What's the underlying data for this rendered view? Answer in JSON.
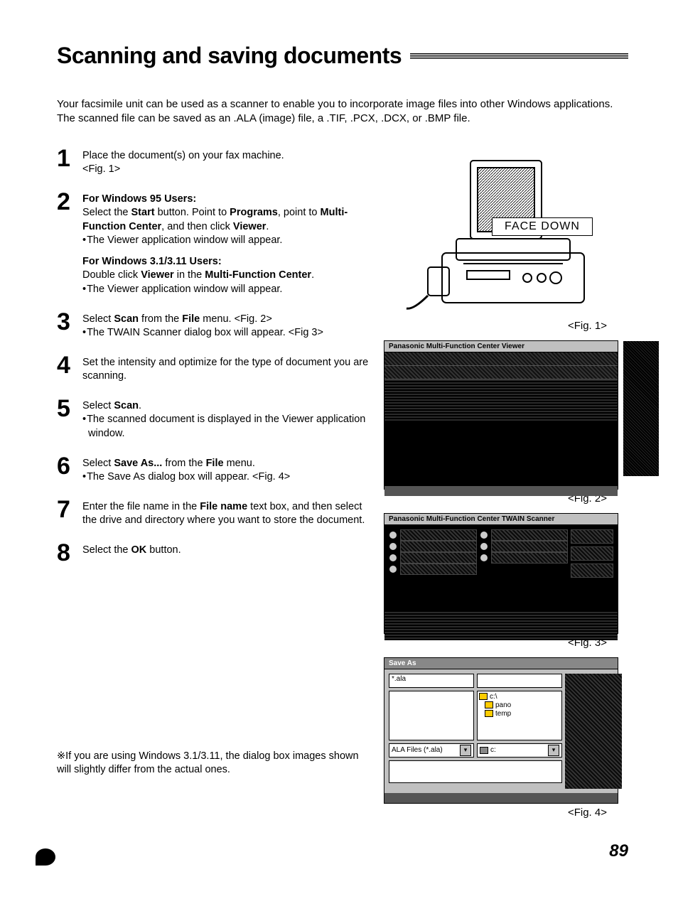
{
  "title": "Scanning and saving documents",
  "intro": "Your facsimile unit can be used as a scanner to enable you to incorporate image files into other Windows applications. The scanned file can be saved as an .ALA (image) file, a .TIF, .PCX, .DCX, or .BMP file.",
  "steps": {
    "s1": {
      "num": "1",
      "line1": "Place the document(s) on your fax machine.",
      "line2": "<Fig. 1>"
    },
    "s2": {
      "num": "2",
      "h1": "For Windows 95 Users:",
      "p1a": "Select the ",
      "p1b": "Start",
      "p1c": " button. Point to ",
      "p1d": "Programs",
      "p1e": ", point to ",
      "p1f": "Multi-Function Center",
      "p1g": ", and then click ",
      "p1h": "Viewer",
      "p1i": ".",
      "b1": "The Viewer application window will appear.",
      "h2": "For Windows 3.1/3.11 Users:",
      "p2a": "Double click ",
      "p2b": "Viewer",
      "p2c": " in the ",
      "p2d": "Multi-Function Center",
      "p2e": ".",
      "b2": "The Viewer application window will appear."
    },
    "s3": {
      "num": "3",
      "p1a": "Select ",
      "p1b": "Scan",
      "p1c": " from the ",
      "p1d": "File",
      "p1e": " menu. <Fig. 2>",
      "b1": "The TWAIN Scanner dialog box will appear. <Fig 3>"
    },
    "s4": {
      "num": "4",
      "p1": "Set the intensity and optimize for the type of document you are scanning."
    },
    "s5": {
      "num": "5",
      "p1a": "Select ",
      "p1b": "Scan",
      "p1c": ".",
      "b1": "The scanned document is displayed in the Viewer application window."
    },
    "s6": {
      "num": "6",
      "p1a": "Select ",
      "p1b": "Save As...",
      "p1c": " from the ",
      "p1d": "File",
      "p1e": " menu.",
      "b1": "The Save As dialog box will appear. <Fig. 4>"
    },
    "s7": {
      "num": "7",
      "p1a": "Enter the file name in the ",
      "p1b": "File name",
      "p1c": " text box, and then select the drive and directory where you want to store the document."
    },
    "s8": {
      "num": "8",
      "p1a": "Select the ",
      "p1b": "OK",
      "p1c": " button."
    }
  },
  "note": "※If you are using Windows 3.1/3.11, the dialog box images shown will slightly differ from the actual ones.",
  "figs": {
    "f1": {
      "cap": "<Fig. 1>",
      "label": "FACE DOWN"
    },
    "f2": {
      "cap": "<Fig. 2>",
      "title": "Panasonic Multi-Function Center Viewer"
    },
    "f3": {
      "cap": "<Fig. 3>",
      "title": "Panasonic Multi-Function Center TWAIN Scanner"
    },
    "f4": {
      "cap": "<Fig. 4>",
      "title": "Save As",
      "filename": "*.ala",
      "dirs": {
        "d1": "c:\\",
        "d2": "pano",
        "d3": "temp"
      },
      "filetype": "ALA Files (*.ala)",
      "drive": "c:"
    }
  },
  "pageNumber": "89"
}
